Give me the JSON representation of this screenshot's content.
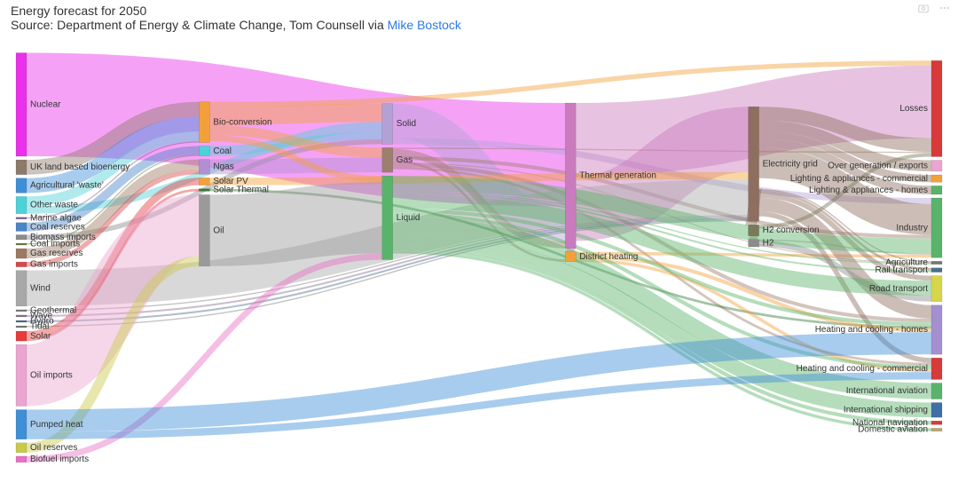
{
  "header": {
    "title": "Energy forecast for 2050",
    "subtitle_prefix": "Source: Department of Energy & Climate Change, Tom Counsell via ",
    "link_text": "Mike Bostock"
  },
  "toolbar": {
    "camera_tooltip": "Download plot as a png",
    "menu_tooltip": "More options"
  },
  "chart_data": {
    "type": "sankey",
    "title": "Energy forecast for 2050",
    "nodes": [
      {
        "name": "Nuclear",
        "col": 0,
        "color": "#e930ea"
      },
      {
        "name": "UK land based bioenergy",
        "col": 0,
        "color": "#8e7a6b"
      },
      {
        "name": "Agricultural 'waste'",
        "col": 0,
        "color": "#3f8fd6"
      },
      {
        "name": "Other waste",
        "col": 0,
        "color": "#4fd1d8"
      },
      {
        "name": "Marine algae",
        "col": 0,
        "color": "#7d5c8c"
      },
      {
        "name": "Coal reserves",
        "col": 0,
        "color": "#4a85c7"
      },
      {
        "name": "Biomass imports",
        "col": 0,
        "color": "#8c8c8c"
      },
      {
        "name": "Coal imports",
        "col": 0,
        "color": "#6c7a3d"
      },
      {
        "name": "Gas reserves",
        "col": 0,
        "color": "#9d7a63"
      },
      {
        "name": "Gas imports",
        "col": 0,
        "color": "#d64a4a"
      },
      {
        "name": "Wind",
        "col": 0,
        "color": "#a8a8a8"
      },
      {
        "name": "Geothermal",
        "col": 0,
        "color": "#777"
      },
      {
        "name": "Wave",
        "col": 0,
        "color": "#8a6f95"
      },
      {
        "name": "Hydro",
        "col": 0,
        "color": "#4f6f8c"
      },
      {
        "name": "Tidal",
        "col": 0,
        "color": "#777"
      },
      {
        "name": "Solar",
        "col": 0,
        "color": "#e63c3c"
      },
      {
        "name": "Oil imports",
        "col": 0,
        "color": "#eaa6d1"
      },
      {
        "name": "Pumped heat",
        "col": 0,
        "color": "#3f8fd6"
      },
      {
        "name": "Oil reserves",
        "col": 0,
        "color": "#c9c94a"
      },
      {
        "name": "Biofuel imports",
        "col": 0,
        "color": "#e86fc3"
      },
      {
        "name": "Bio-conversion",
        "col": 1,
        "color": "#f2a13a"
      },
      {
        "name": "Coal",
        "col": 1,
        "color": "#4fd1d8"
      },
      {
        "name": "Ngas",
        "col": 1,
        "color": "#b28fd1"
      },
      {
        "name": "Solar PV",
        "col": 1,
        "color": "#f2a13a"
      },
      {
        "name": "Solar Thermal",
        "col": 1,
        "color": "#3a7a3a"
      },
      {
        "name": "Oil",
        "col": 1,
        "color": "#9a9a9a"
      },
      {
        "name": "Solid",
        "col": 2,
        "color": "#b3a1d6"
      },
      {
        "name": "Gas",
        "col": 2,
        "color": "#9d7f6d"
      },
      {
        "name": "Liquid",
        "col": 2,
        "color": "#5ab36b"
      },
      {
        "name": "Thermal generation",
        "col": 3,
        "color": "#c97bbd"
      },
      {
        "name": "District heating",
        "col": 3,
        "color": "#f2a13a"
      },
      {
        "name": "Electricity grid",
        "col": 4,
        "color": "#8e6f5f"
      },
      {
        "name": "H2 conversion",
        "col": 4,
        "color": "#7a7a5a"
      },
      {
        "name": "H2",
        "col": 4,
        "color": "#8c8c8c"
      },
      {
        "name": "Losses",
        "col": 5,
        "color": "#d83a3a"
      },
      {
        "name": "Over generation / exports",
        "col": 5,
        "color": "#eaa6d1"
      },
      {
        "name": "Lighting & appliances - commercial",
        "col": 5,
        "color": "#f2a13a"
      },
      {
        "name": "Lighting & appliances - homes",
        "col": 5,
        "color": "#5ab36b"
      },
      {
        "name": "Industry",
        "col": 5,
        "color": "#5ab36b"
      },
      {
        "name": "Agriculture",
        "col": 5,
        "color": "#777"
      },
      {
        "name": "Rail transport",
        "col": 5,
        "color": "#4a6f8c"
      },
      {
        "name": "Road transport",
        "col": 5,
        "color": "#d6d64a"
      },
      {
        "name": "Heating and cooling - homes",
        "col": 5,
        "color": "#a48fd1"
      },
      {
        "name": "Heating and cooling - commercial",
        "col": 5,
        "color": "#d83a3a"
      },
      {
        "name": "International aviation",
        "col": 5,
        "color": "#5ab36b"
      },
      {
        "name": "International shipping",
        "col": 5,
        "color": "#3f6fa6"
      },
      {
        "name": "National navigation",
        "col": 5,
        "color": "#d83a3a"
      },
      {
        "name": "Domestic aviation",
        "col": 5,
        "color": "#bfa66b"
      }
    ],
    "links": [
      {
        "source": "Nuclear",
        "target": "Thermal generation",
        "value": 840
      },
      {
        "source": "UK land based bioenergy",
        "target": "Bio-conversion",
        "value": 120
      },
      {
        "source": "Agricultural 'waste'",
        "target": "Bio-conversion",
        "value": 120
      },
      {
        "source": "Other waste",
        "target": "Bio-conversion",
        "value": 80
      },
      {
        "source": "Other waste",
        "target": "Solid",
        "value": 60
      },
      {
        "source": "Marine algae",
        "target": "Bio-conversion",
        "value": 10
      },
      {
        "source": "Biomass imports",
        "target": "Solid",
        "value": 40
      },
      {
        "source": "Coal reserves",
        "target": "Coal",
        "value": 70
      },
      {
        "source": "Coal imports",
        "target": "Coal",
        "value": 10
      },
      {
        "source": "Coal",
        "target": "Solid",
        "value": 80
      },
      {
        "source": "Gas reserves",
        "target": "Ngas",
        "value": 80
      },
      {
        "source": "Gas imports",
        "target": "Ngas",
        "value": 40
      },
      {
        "source": "Ngas",
        "target": "Gas",
        "value": 120
      },
      {
        "source": "Bio-conversion",
        "target": "Solid",
        "value": 150
      },
      {
        "source": "Bio-conversion",
        "target": "Gas",
        "value": 80
      },
      {
        "source": "Bio-conversion",
        "target": "Liquid",
        "value": 50
      },
      {
        "source": "Bio-conversion",
        "target": "Losses",
        "value": 40
      },
      {
        "source": "Solid",
        "target": "Thermal generation",
        "value": 280
      },
      {
        "source": "Solid",
        "target": "Industry",
        "value": 50
      },
      {
        "source": "Gas",
        "target": "Thermal generation",
        "value": 60
      },
      {
        "source": "Gas",
        "target": "Heating and cooling - homes",
        "value": 30
      },
      {
        "source": "Gas",
        "target": "Heating and cooling - commercial",
        "value": 20
      },
      {
        "source": "Gas",
        "target": "Industry",
        "value": 30
      },
      {
        "source": "Gas",
        "target": "Losses",
        "value": 10
      },
      {
        "source": "Gas",
        "target": "Agriculture",
        "value": 5
      },
      {
        "source": "Gas",
        "target": "District heating",
        "value": 20
      },
      {
        "source": "Thermal generation",
        "target": "Electricity grid",
        "value": 530
      },
      {
        "source": "Thermal generation",
        "target": "Losses",
        "value": 590
      },
      {
        "source": "Thermal generation",
        "target": "District heating",
        "value": 60
      },
      {
        "source": "Wind",
        "target": "Electricity grid",
        "value": 290
      },
      {
        "source": "Geothermal",
        "target": "Electricity grid",
        "value": 10
      },
      {
        "source": "Wave",
        "target": "Electricity grid",
        "value": 15
      },
      {
        "source": "Hydro",
        "target": "Electricity grid",
        "value": 15
      },
      {
        "source": "Tidal",
        "target": "Electricity grid",
        "value": 10
      },
      {
        "source": "Solar",
        "target": "Solar PV",
        "value": 60
      },
      {
        "source": "Solar",
        "target": "Solar Thermal",
        "value": 20
      },
      {
        "source": "Solar PV",
        "target": "Electricity grid",
        "value": 60
      },
      {
        "source": "Solar Thermal",
        "target": "Heating and cooling - homes",
        "value": 20
      },
      {
        "source": "District heating",
        "target": "Heating and cooling - homes",
        "value": 30
      },
      {
        "source": "District heating",
        "target": "Heating and cooling - commercial",
        "value": 25
      },
      {
        "source": "District heating",
        "target": "Industry",
        "value": 25
      },
      {
        "source": "Electricity grid",
        "target": "Over generation / exports",
        "value": 90
      },
      {
        "source": "Electricity grid",
        "target": "Lighting & appliances - commercial",
        "value": 60
      },
      {
        "source": "Electricity grid",
        "target": "Lighting & appliances - homes",
        "value": 70
      },
      {
        "source": "Electricity grid",
        "target": "Industry",
        "value": 250
      },
      {
        "source": "Electricity grid",
        "target": "Heating and cooling - homes",
        "value": 110
      },
      {
        "source": "Electricity grid",
        "target": "Heating and cooling - commercial",
        "value": 40
      },
      {
        "source": "Electricity grid",
        "target": "Rail transport",
        "value": 20
      },
      {
        "source": "Electricity grid",
        "target": "Road transport",
        "value": 40
      },
      {
        "source": "Electricity grid",
        "target": "H2 conversion",
        "value": 90
      },
      {
        "source": "Electricity grid",
        "target": "Agriculture",
        "value": 10
      },
      {
        "source": "Electricity grid",
        "target": "Losses",
        "value": 110
      },
      {
        "source": "H2 conversion",
        "target": "H2",
        "value": 60
      },
      {
        "source": "H2 conversion",
        "target": "Losses",
        "value": 30
      },
      {
        "source": "H2",
        "target": "Road transport",
        "value": 50
      },
      {
        "source": "H2",
        "target": "Industry",
        "value": 10
      },
      {
        "source": "Oil imports",
        "target": "Oil",
        "value": 500
      },
      {
        "source": "Oil reserves",
        "target": "Oil",
        "value": 80
      },
      {
        "source": "Oil",
        "target": "Liquid",
        "value": 580
      },
      {
        "source": "Biofuel imports",
        "target": "Liquid",
        "value": 50
      },
      {
        "source": "Liquid",
        "target": "Road transport",
        "value": 120
      },
      {
        "source": "Liquid",
        "target": "International aviation",
        "value": 130
      },
      {
        "source": "Liquid",
        "target": "International shipping",
        "value": 120
      },
      {
        "source": "Liquid",
        "target": "National navigation",
        "value": 30
      },
      {
        "source": "Liquid",
        "target": "Domestic aviation",
        "value": 25
      },
      {
        "source": "Liquid",
        "target": "Industry",
        "value": 120
      },
      {
        "source": "Liquid",
        "target": "Rail transport",
        "value": 15
      },
      {
        "source": "Liquid",
        "target": "Agriculture",
        "value": 10
      },
      {
        "source": "Liquid",
        "target": "Heating and cooling - homes",
        "value": 30
      },
      {
        "source": "Liquid",
        "target": "Heating and cooling - commercial",
        "value": 30
      },
      {
        "source": "Pumped heat",
        "target": "Heating and cooling - homes",
        "value": 180
      },
      {
        "source": "Pumped heat",
        "target": "Heating and cooling - commercial",
        "value": 60
      }
    ]
  }
}
